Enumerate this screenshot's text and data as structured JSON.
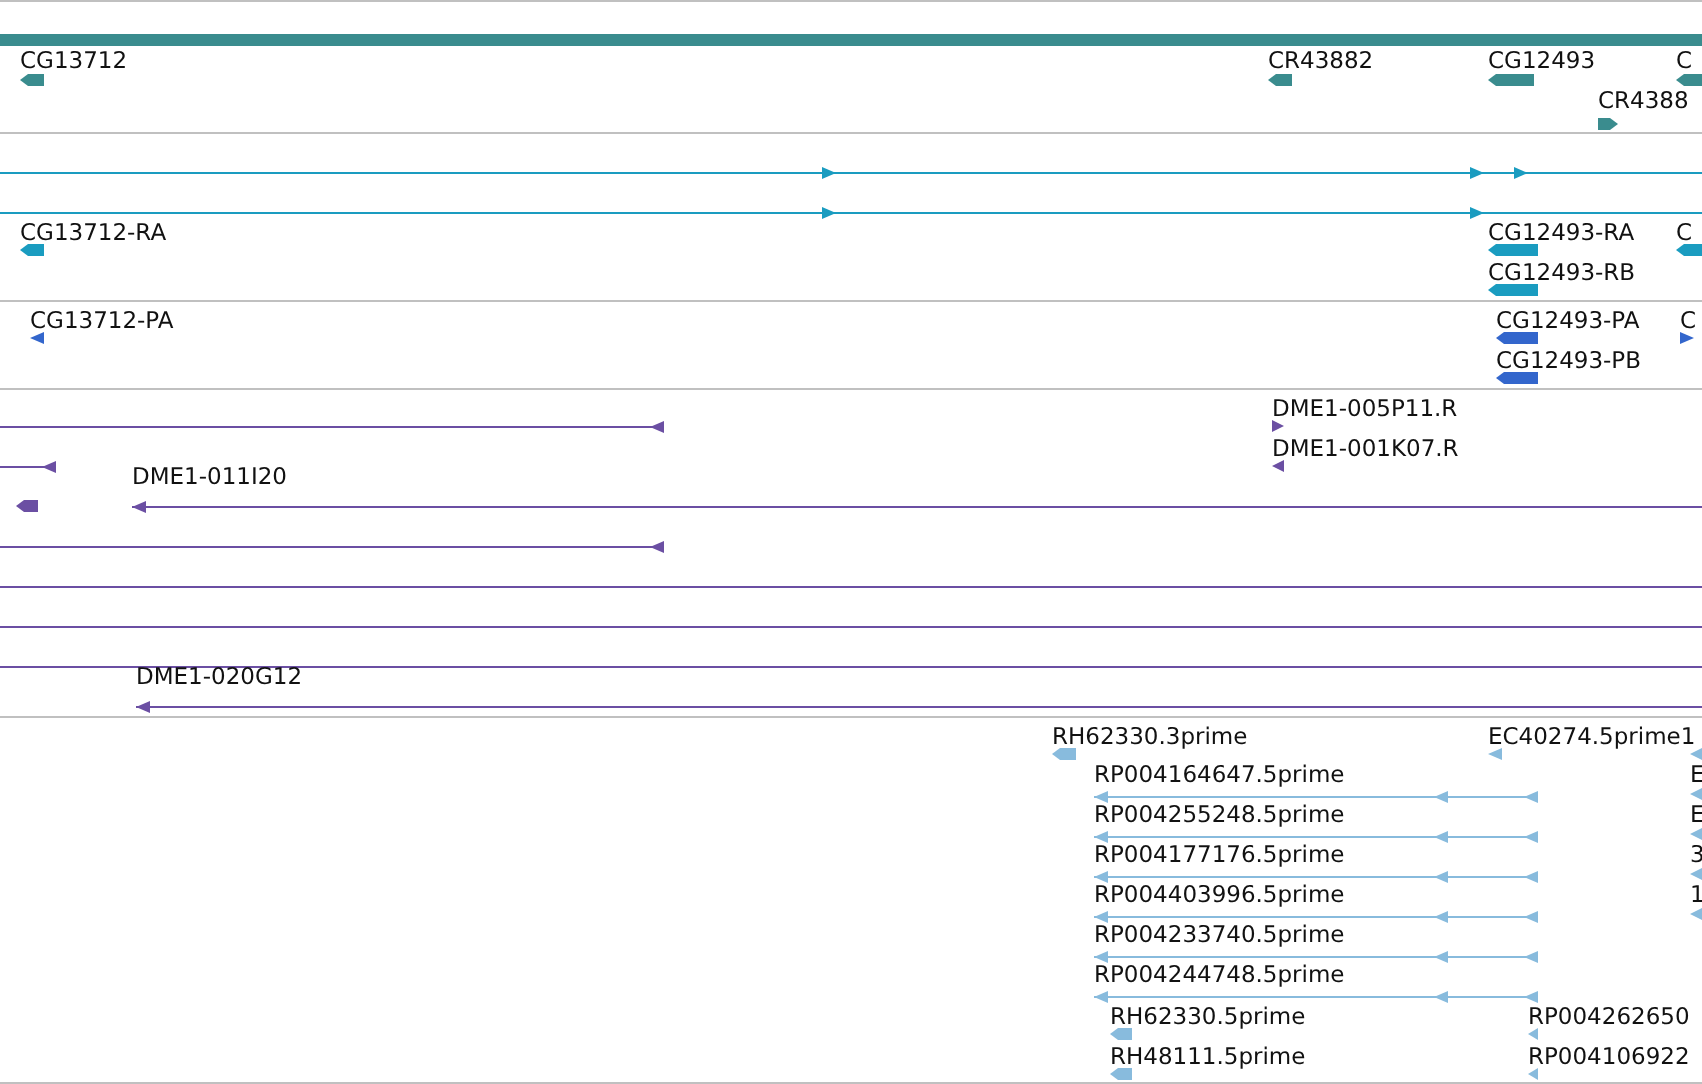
{
  "tracks": [
    {
      "color": "#3a8c8e",
      "features": [
        {
          "label": "CG13712",
          "reverse": true
        },
        {
          "label": "CR43882",
          "reverse": true
        },
        {
          "label": "CG12493",
          "reverse": true
        },
        {
          "label": "C",
          "reverse": true
        },
        {
          "label": "CR4388",
          "reverse": false
        }
      ]
    },
    {
      "color": "#1a9cc0",
      "features": [
        {
          "reverse": false
        },
        {
          "reverse": false
        },
        {
          "label": "CG13712-RA",
          "reverse": true
        },
        {
          "label": "CG12493-RA",
          "reverse": true
        },
        {
          "label": "C",
          "reverse": true
        },
        {
          "label": "CG12493-RB",
          "reverse": true
        }
      ]
    },
    {
      "color": "#3366cc",
      "features": [
        {
          "label": "CG13712-PA",
          "reverse": true
        },
        {
          "label": "CG12493-PA",
          "reverse": true
        },
        {
          "label": "C",
          "reverse": false
        },
        {
          "label": "CG12493-PB",
          "reverse": true
        }
      ]
    },
    {
      "color": "#6b4fa3",
      "features": [
        {
          "label": "DME1-005P11.R",
          "reverse": false
        },
        {
          "reverse": true
        },
        {
          "label": "DME1-001K07.R",
          "reverse": true
        },
        {
          "reverse": true
        },
        {
          "reverse": true
        },
        {
          "label": "DME1-011I20",
          "reverse": true
        },
        {
          "reverse": true
        },
        {
          "reverse": true
        },
        {
          "reverse": true
        },
        {
          "reverse": true
        },
        {
          "label": "DME1-020G12",
          "reverse": true
        }
      ]
    },
    {
      "color": "#88bbdd",
      "features": [
        {
          "label": "RH62330.3prime",
          "reverse": true
        },
        {
          "label": "EC40274.5prime1",
          "reverse": true
        },
        {
          "reverse": true
        },
        {
          "label": "RP004164647.5prime",
          "reverse": true
        },
        {
          "label": "E",
          "reverse": true
        },
        {
          "label": "RP004255248.5prime",
          "reverse": true
        },
        {
          "label": "E",
          "reverse": true
        },
        {
          "label": "RP004177176.5prime",
          "reverse": true
        },
        {
          "label": "3",
          "reverse": true
        },
        {
          "label": "RP004403996.5prime",
          "reverse": true
        },
        {
          "label": "1",
          "reverse": true
        },
        {
          "label": "RP004233740.5prime",
          "reverse": true
        },
        {
          "label": "RP004244748.5prime",
          "reverse": true
        },
        {
          "label": "RH62330.5prime",
          "reverse": true
        },
        {
          "label": "RP004262650",
          "reverse": true
        },
        {
          "label": "RH48111.5prime",
          "reverse": true
        },
        {
          "label": "RP004106922",
          "reverse": true
        }
      ]
    }
  ]
}
